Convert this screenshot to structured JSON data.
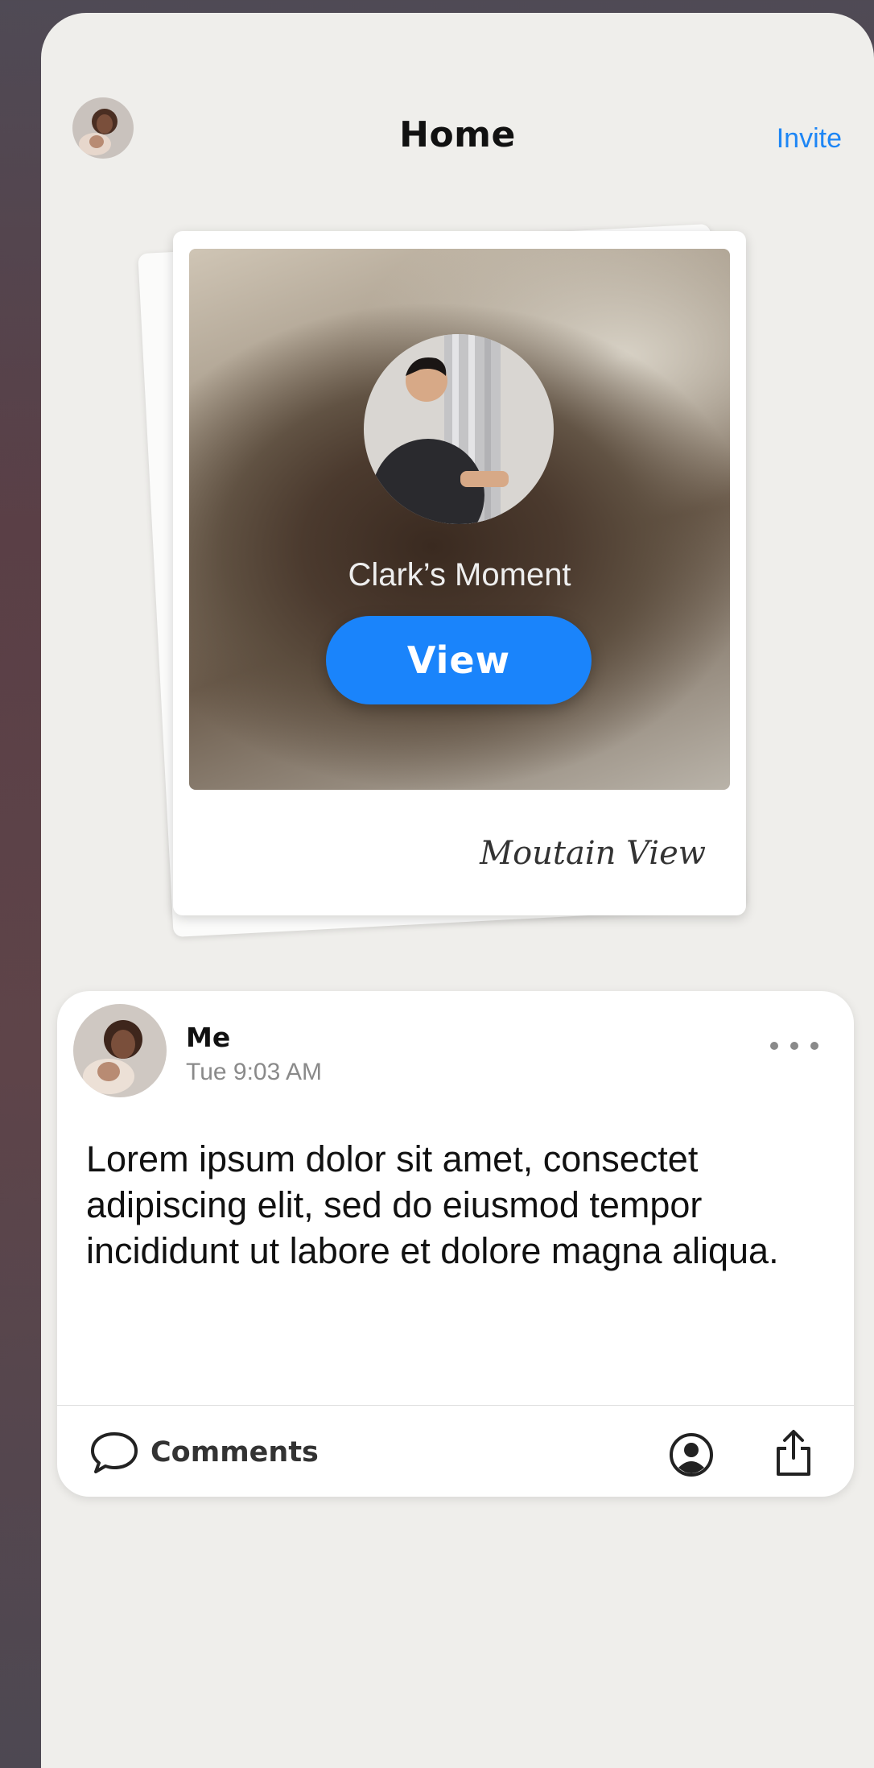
{
  "header": {
    "title": "Home",
    "invite_label": "Invite"
  },
  "moment": {
    "name": "Clark’s Moment",
    "view_label": "View",
    "caption": "Moutain View"
  },
  "post": {
    "author": "Me",
    "timestamp": "Tue 9:03 AM",
    "body": "Lorem ipsum dolor sit amet, consectet adipiscing elit, sed do eiusmod tempor incididunt ut labore et dolore magna aliqua.",
    "comments_label": "Comments"
  },
  "colors": {
    "accent": "#1a84fb",
    "background": "#efeeeb",
    "card": "#ffffff"
  },
  "icons": [
    "user-avatar",
    "moment-avatar",
    "more-icon",
    "comment-icon",
    "profile-icon",
    "share-icon"
  ]
}
